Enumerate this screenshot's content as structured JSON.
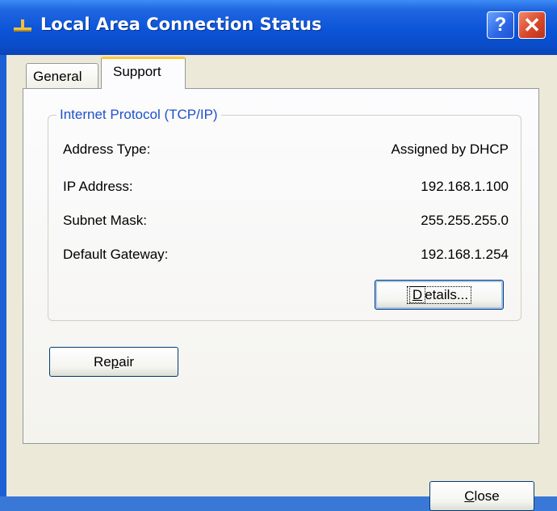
{
  "window": {
    "title": "Local Area Connection Status",
    "help_glyph": "?",
    "close_glyph": "✕"
  },
  "tabs": [
    {
      "label": "General",
      "selected": false
    },
    {
      "label": "Support",
      "selected": true
    }
  ],
  "group": {
    "legend": "Internet Protocol (TCP/IP)",
    "rows": [
      {
        "label": "Address Type:",
        "value": "Assigned by DHCP"
      },
      {
        "label": "IP Address:",
        "value": "192.168.1.100"
      },
      {
        "label": "Subnet Mask:",
        "value": "255.255.255.0"
      },
      {
        "label": "Default Gateway:",
        "value": "192.168.1.254"
      }
    ]
  },
  "buttons": {
    "details": {
      "label": "Details...",
      "mnemonic_index": 0
    },
    "repair": {
      "label": "Repair",
      "mnemonic_index": 2
    },
    "close": {
      "label": "Close",
      "mnemonic_index": 0
    }
  },
  "colors": {
    "title_bar": "#0b54d8",
    "dialog_bg": "#ece9d8",
    "group_legend": "#1f50d0",
    "selected_tab_accent": "#ffc83d"
  },
  "icons": {
    "title": "network-connection-icon",
    "help": "help-icon",
    "close": "close-icon"
  }
}
